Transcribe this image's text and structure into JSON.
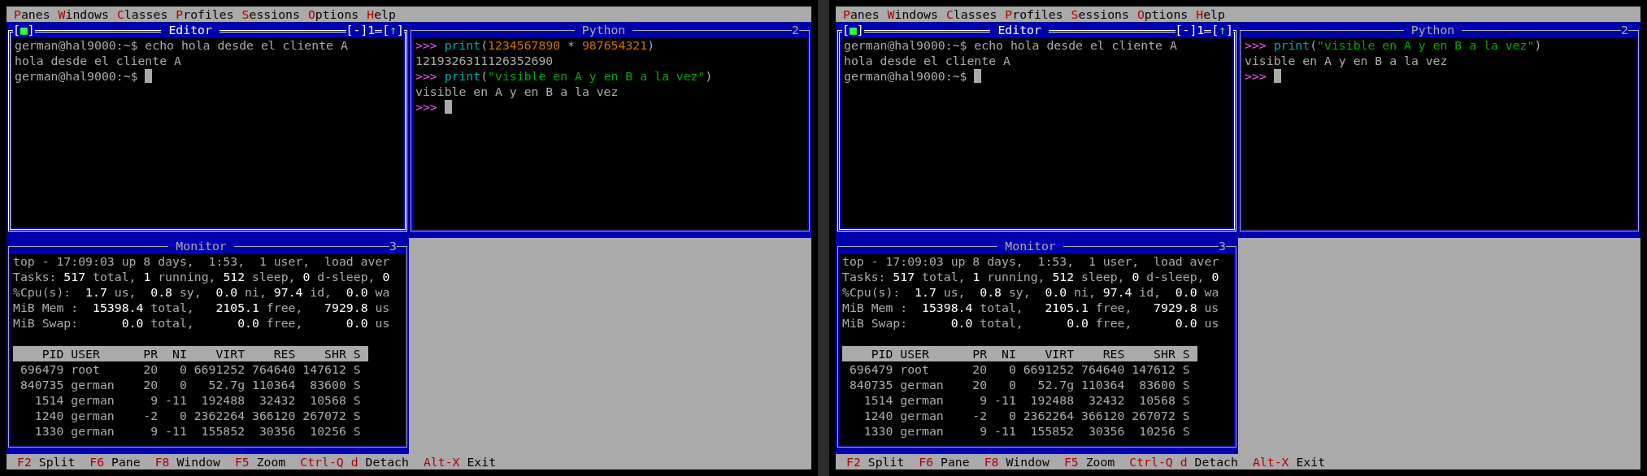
{
  "screens": [
    {
      "menu": [
        {
          "label": "Panes"
        },
        {
          "label": "Windows"
        },
        {
          "label": "Classes"
        },
        {
          "label": "Profiles"
        },
        {
          "label": "Sessions"
        },
        {
          "label": "Options"
        },
        {
          "label": "Help"
        }
      ],
      "windows": [
        {
          "title": "Editor",
          "active": true,
          "close_button": "[■]",
          "minimize_button": "[-]",
          "number": "1",
          "maximize_button": "[↑]",
          "lines": [
            {
              "segments": [
                {
                  "text": "german@hal9000:~$ echo hola desde el cliente A",
                  "kind": "plain"
                }
              ]
            },
            {
              "segments": [
                {
                  "text": "hola desde el cliente A",
                  "kind": "plain"
                }
              ]
            },
            {
              "segments": [
                {
                  "text": "german@hal9000:~$",
                  "kind": "plain"
                }
              ],
              "cursor": true
            }
          ]
        },
        {
          "title": "Python",
          "active": false,
          "number": "2",
          "lines": [
            {
              "segments": [
                {
                  "text": ">>>",
                  "kind": "prompt"
                },
                {
                  "text": " print",
                  "kind": "function"
                },
                {
                  "text": "(",
                  "kind": "plain"
                },
                {
                  "text": "1234567890",
                  "kind": "number"
                },
                {
                  "text": " * ",
                  "kind": "plain"
                },
                {
                  "text": "987654321",
                  "kind": "number"
                },
                {
                  "text": ")",
                  "kind": "plain"
                }
              ]
            },
            {
              "segments": [
                {
                  "text": "1219326311126352690",
                  "kind": "plain"
                }
              ]
            },
            {
              "segments": [
                {
                  "text": ">>>",
                  "kind": "prompt"
                },
                {
                  "text": " print",
                  "kind": "function"
                },
                {
                  "text": "(",
                  "kind": "plain"
                },
                {
                  "text": "\"visible en A y en B a la vez\"",
                  "kind": "string"
                },
                {
                  "text": ")",
                  "kind": "plain"
                }
              ]
            },
            {
              "segments": [
                {
                  "text": "visible en A y en B a la vez",
                  "kind": "plain"
                }
              ]
            },
            {
              "segments": [
                {
                  "text": ">>>",
                  "kind": "prompt"
                }
              ],
              "cursor": true
            }
          ]
        },
        {
          "title": "Monitor",
          "active": false,
          "number": "3",
          "lines": [
            {
              "segments": [
                {
                  "text": "top - 17:09:03 up 8 days,  1:53,  1 user,  load aver",
                  "kind": "plain"
                }
              ]
            },
            {
              "segments": [
                {
                  "text": "Tasks: ",
                  "kind": "plain"
                },
                {
                  "text": "517",
                  "kind": "bright"
                },
                {
                  "text": " total, ",
                  "kind": "plain"
                },
                {
                  "text": "1",
                  "kind": "bright"
                },
                {
                  "text": " running, ",
                  "kind": "plain"
                },
                {
                  "text": "512",
                  "kind": "bright"
                },
                {
                  "text": " sleep, ",
                  "kind": "plain"
                },
                {
                  "text": "0",
                  "kind": "bright"
                },
                {
                  "text": " d-sleep, ",
                  "kind": "plain"
                },
                {
                  "text": "0",
                  "kind": "bright"
                }
              ]
            },
            {
              "segments": [
                {
                  "text": "%Cpu(s):  ",
                  "kind": "plain"
                },
                {
                  "text": "1.7",
                  "kind": "bright"
                },
                {
                  "text": " us,  ",
                  "kind": "plain"
                },
                {
                  "text": "0.8",
                  "kind": "bright"
                },
                {
                  "text": " sy,  ",
                  "kind": "plain"
                },
                {
                  "text": "0.0",
                  "kind": "bright"
                },
                {
                  "text": " ni, ",
                  "kind": "plain"
                },
                {
                  "text": "97.4",
                  "kind": "bright"
                },
                {
                  "text": " id,  ",
                  "kind": "plain"
                },
                {
                  "text": "0.0",
                  "kind": "bright"
                },
                {
                  "text": " wa",
                  "kind": "plain"
                }
              ]
            },
            {
              "segments": [
                {
                  "text": "MiB Mem :  ",
                  "kind": "plain"
                },
                {
                  "text": "15398.4",
                  "kind": "bright"
                },
                {
                  "text": " total,   ",
                  "kind": "plain"
                },
                {
                  "text": "2105.1",
                  "kind": "bright"
                },
                {
                  "text": " free,   ",
                  "kind": "plain"
                },
                {
                  "text": "7929.8",
                  "kind": "bright"
                },
                {
                  "text": " us",
                  "kind": "plain"
                }
              ]
            },
            {
              "segments": [
                {
                  "text": "MiB Swap:      ",
                  "kind": "plain"
                },
                {
                  "text": "0.0",
                  "kind": "bright"
                },
                {
                  "text": " total,      ",
                  "kind": "plain"
                },
                {
                  "text": "0.0",
                  "kind": "bright"
                },
                {
                  "text": " free,      ",
                  "kind": "plain"
                },
                {
                  "text": "0.0",
                  "kind": "bright"
                },
                {
                  "text": " us",
                  "kind": "plain"
                }
              ]
            },
            {
              "kind": "blank"
            },
            {
              "kind": "header",
              "segments": [
                {
                  "text": "    PID USER      PR  NI    VIRT    RES    SHR S ",
                  "kind": "plain"
                }
              ]
            },
            {
              "segments": [
                {
                  "text": " 696479 root      20   0 6691252 764640 147612 S",
                  "kind": "plain"
                }
              ]
            },
            {
              "segments": [
                {
                  "text": " 840735 german    20   0   52.7g 110364  83600 S",
                  "kind": "plain"
                }
              ]
            },
            {
              "segments": [
                {
                  "text": "   1514 german     9 -11  192488  32432  10568 S",
                  "kind": "plain"
                }
              ]
            },
            {
              "segments": [
                {
                  "text": "   1240 german    -2   0 2362264 366120 267072 S",
                  "kind": "plain"
                }
              ]
            },
            {
              "segments": [
                {
                  "text": "   1330 german     9 -11  155852  30356  10256 S",
                  "kind": "plain"
                }
              ]
            }
          ]
        }
      ],
      "status_bar": [
        {
          "key": "F2",
          "label": "Split"
        },
        {
          "key": "F6",
          "label": "Pane"
        },
        {
          "key": "F8",
          "label": "Window"
        },
        {
          "key": "F5",
          "label": "Zoom"
        },
        {
          "key": "Ctrl-Q d",
          "label": "Detach"
        },
        {
          "key": "Alt-X",
          "label": "Exit"
        }
      ]
    },
    {
      "menu": [
        {
          "label": "Panes"
        },
        {
          "label": "Windows"
        },
        {
          "label": "Classes"
        },
        {
          "label": "Profiles"
        },
        {
          "label": "Sessions"
        },
        {
          "label": "Options"
        },
        {
          "label": "Help"
        }
      ],
      "windows": [
        {
          "title": "Editor",
          "active": true,
          "close_button": "[■]",
          "minimize_button": "[-]",
          "number": "1",
          "maximize_button": "[↑]",
          "lines": [
            {
              "segments": [
                {
                  "text": "german@hal9000:~$ echo hola desde el cliente A",
                  "kind": "plain"
                }
              ]
            },
            {
              "segments": [
                {
                  "text": "hola desde el cliente A",
                  "kind": "plain"
                }
              ]
            },
            {
              "segments": [
                {
                  "text": "german@hal9000:~$",
                  "kind": "plain"
                }
              ],
              "cursor": true
            }
          ]
        },
        {
          "title": "Python",
          "active": false,
          "number": "2",
          "lines": [
            {
              "segments": [
                {
                  "text": ">>>",
                  "kind": "prompt"
                },
                {
                  "text": " print",
                  "kind": "function"
                },
                {
                  "text": "(",
                  "kind": "plain"
                },
                {
                  "text": "\"visible en A y en B a la vez\"",
                  "kind": "string"
                },
                {
                  "text": ")",
                  "kind": "plain"
                }
              ]
            },
            {
              "segments": [
                {
                  "text": "visible en A y en B a la vez",
                  "kind": "plain"
                }
              ]
            },
            {
              "segments": [
                {
                  "text": ">>>",
                  "kind": "prompt"
                }
              ],
              "cursor": true
            }
          ]
        },
        {
          "title": "Monitor",
          "active": false,
          "number": "3",
          "lines": [
            {
              "segments": [
                {
                  "text": "top - 17:09:03 up 8 days,  1:53,  1 user,  load aver",
                  "kind": "plain"
                }
              ]
            },
            {
              "segments": [
                {
                  "text": "Tasks: ",
                  "kind": "plain"
                },
                {
                  "text": "517",
                  "kind": "bright"
                },
                {
                  "text": " total, ",
                  "kind": "plain"
                },
                {
                  "text": "1",
                  "kind": "bright"
                },
                {
                  "text": " running, ",
                  "kind": "plain"
                },
                {
                  "text": "512",
                  "kind": "bright"
                },
                {
                  "text": " sleep, ",
                  "kind": "plain"
                },
                {
                  "text": "0",
                  "kind": "bright"
                },
                {
                  "text": " d-sleep, ",
                  "kind": "plain"
                },
                {
                  "text": "0",
                  "kind": "bright"
                }
              ]
            },
            {
              "segments": [
                {
                  "text": "%Cpu(s):  ",
                  "kind": "plain"
                },
                {
                  "text": "1.7",
                  "kind": "bright"
                },
                {
                  "text": " us,  ",
                  "kind": "plain"
                },
                {
                  "text": "0.8",
                  "kind": "bright"
                },
                {
                  "text": " sy,  ",
                  "kind": "plain"
                },
                {
                  "text": "0.0",
                  "kind": "bright"
                },
                {
                  "text": " ni, ",
                  "kind": "plain"
                },
                {
                  "text": "97.4",
                  "kind": "bright"
                },
                {
                  "text": " id,  ",
                  "kind": "plain"
                },
                {
                  "text": "0.0",
                  "kind": "bright"
                },
                {
                  "text": " wa",
                  "kind": "plain"
                }
              ]
            },
            {
              "segments": [
                {
                  "text": "MiB Mem :  ",
                  "kind": "plain"
                },
                {
                  "text": "15398.4",
                  "kind": "bright"
                },
                {
                  "text": " total,   ",
                  "kind": "plain"
                },
                {
                  "text": "2105.1",
                  "kind": "bright"
                },
                {
                  "text": " free,   ",
                  "kind": "plain"
                },
                {
                  "text": "7929.8",
                  "kind": "bright"
                },
                {
                  "text": " us",
                  "kind": "plain"
                }
              ]
            },
            {
              "segments": [
                {
                  "text": "MiB Swap:      ",
                  "kind": "plain"
                },
                {
                  "text": "0.0",
                  "kind": "bright"
                },
                {
                  "text": " total,      ",
                  "kind": "plain"
                },
                {
                  "text": "0.0",
                  "kind": "bright"
                },
                {
                  "text": " free,      ",
                  "kind": "plain"
                },
                {
                  "text": "0.0",
                  "kind": "bright"
                },
                {
                  "text": " us",
                  "kind": "plain"
                }
              ]
            },
            {
              "kind": "blank"
            },
            {
              "kind": "header",
              "segments": [
                {
                  "text": "    PID USER      PR  NI    VIRT    RES    SHR S ",
                  "kind": "plain"
                }
              ]
            },
            {
              "segments": [
                {
                  "text": " 696479 root      20   0 6691252 764640 147612 S",
                  "kind": "plain"
                }
              ]
            },
            {
              "segments": [
                {
                  "text": " 840735 german    20   0   52.7g 110364  83600 S",
                  "kind": "plain"
                }
              ]
            },
            {
              "segments": [
                {
                  "text": "   1514 german     9 -11  192488  32432  10568 S",
                  "kind": "plain"
                }
              ]
            },
            {
              "segments": [
                {
                  "text": "   1240 german    -2   0 2362264 366120 267072 S",
                  "kind": "plain"
                }
              ]
            },
            {
              "segments": [
                {
                  "text": "   1330 german     9 -11  155852  30356  10256 S",
                  "kind": "plain"
                }
              ]
            }
          ]
        }
      ],
      "status_bar": [
        {
          "key": "F2",
          "label": "Split"
        },
        {
          "key": "F6",
          "label": "Pane"
        },
        {
          "key": "F8",
          "label": "Window"
        },
        {
          "key": "F5",
          "label": "Zoom"
        },
        {
          "key": "Ctrl-Q d",
          "label": "Detach"
        },
        {
          "key": "Alt-X",
          "label": "Exit"
        }
      ]
    }
  ]
}
